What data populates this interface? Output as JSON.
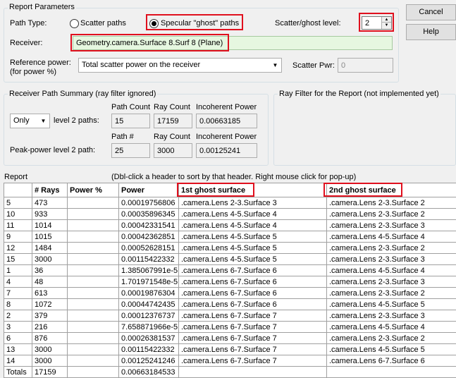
{
  "buttons": {
    "cancel": "Cancel",
    "help": "Help"
  },
  "params": {
    "group_title": "Report Parameters",
    "path_type_label": "Path Type:",
    "scatter_paths_label": "Scatter paths",
    "specular_label": "Specular \"ghost\" paths",
    "selected_path_type": "specular",
    "level_label": "Scatter/ghost level:",
    "level_value": "2",
    "receiver_label": "Receiver:",
    "receiver_value": "Geometry.camera.Surface 8.Surf 8  (Plane)",
    "ref_power_label": "Reference power:",
    "ref_power_label2": "(for power %)",
    "ref_power_value": "Total scatter power on the receiver",
    "scatter_pwr_label": "Scatter Pwr:",
    "scatter_pwr_value": "0"
  },
  "summary": {
    "group_title": "Receiver Path Summary (ray filter ignored)",
    "col_path_count": "Path Count",
    "col_ray_count": "Ray Count",
    "col_incoherent": "Incoherent Power",
    "filter_select": "Only",
    "level_paths_label": "level 2 paths:",
    "path_count": "15",
    "ray_count": "17159",
    "incoherent_power": "0.00663185",
    "col_path_num": "Path #",
    "col_ray_count2": "Ray Count",
    "col_incoherent2": "Incoherent Power",
    "peak_label": "Peak-power level 2 path:",
    "peak_path": "25",
    "peak_rays": "3000",
    "peak_power": "0.00125241"
  },
  "ray_filter": {
    "group_title": "Ray Filter for the Report (not implemented yet)"
  },
  "report": {
    "label": "Report",
    "hint": "(Dbl-click a header to sort by that header. Right mouse click for pop-up)",
    "columns": [
      "",
      "# Rays",
      "Power %",
      "Power",
      "1st ghost surface",
      "2nd ghost surface"
    ],
    "rows": [
      [
        "5",
        "473",
        "",
        "0.00019756806",
        ".camera.Lens 2-3.Surface 3",
        ".camera.Lens 2-3.Surface 2"
      ],
      [
        "10",
        "933",
        "",
        "0.00035896345",
        ".camera.Lens 4-5.Surface 4",
        ".camera.Lens 2-3.Surface 2"
      ],
      [
        "11",
        "1014",
        "",
        "0.00042331541",
        ".camera.Lens 4-5.Surface 4",
        ".camera.Lens 2-3.Surface 3"
      ],
      [
        "9",
        "1015",
        "",
        "0.00042362851",
        ".camera.Lens 4-5.Surface 5",
        ".camera.Lens 4-5.Surface 4"
      ],
      [
        "12",
        "1484",
        "",
        "0.00052628151",
        ".camera.Lens 4-5.Surface 5",
        ".camera.Lens 2-3.Surface 2"
      ],
      [
        "15",
        "3000",
        "",
        "0.00115422332",
        ".camera.Lens 4-5.Surface 5",
        ".camera.Lens 2-3.Surface 3"
      ],
      [
        "1",
        "36",
        "",
        "1.385067991e-5",
        ".camera.Lens 6-7.Surface 6",
        ".camera.Lens 4-5.Surface 4"
      ],
      [
        "4",
        "48",
        "",
        "1.701971548e-5",
        ".camera.Lens 6-7.Surface 6",
        ".camera.Lens 2-3.Surface 3"
      ],
      [
        "7",
        "613",
        "",
        "0.00019876304",
        ".camera.Lens 6-7.Surface 6",
        ".camera.Lens 2-3.Surface 2"
      ],
      [
        "8",
        "1072",
        "",
        "0.00044742435",
        ".camera.Lens 6-7.Surface 6",
        ".camera.Lens 4-5.Surface 5"
      ],
      [
        "2",
        "379",
        "",
        "0.00012376737",
        ".camera.Lens 6-7.Surface 7",
        ".camera.Lens 2-3.Surface 3"
      ],
      [
        "3",
        "216",
        "",
        "7.658871966e-5",
        ".camera.Lens 6-7.Surface 7",
        ".camera.Lens 4-5.Surface 4"
      ],
      [
        "6",
        "876",
        "",
        "0.00026381537",
        ".camera.Lens 6-7.Surface 7",
        ".camera.Lens 2-3.Surface 2"
      ],
      [
        "13",
        "3000",
        "",
        "0.00115422332",
        ".camera.Lens 6-7.Surface 7",
        ".camera.Lens 4-5.Surface 5"
      ],
      [
        "14",
        "3000",
        "",
        "0.00125241246",
        ".camera.Lens 6-7.Surface 7",
        ".camera.Lens 6-7.Surface 6"
      ]
    ],
    "totals": [
      "Totals",
      "17159",
      "",
      "0.00663184533",
      "",
      ""
    ]
  },
  "colors": {
    "highlight": "#e0101e",
    "receiver_bg": "#e6f7e0"
  }
}
